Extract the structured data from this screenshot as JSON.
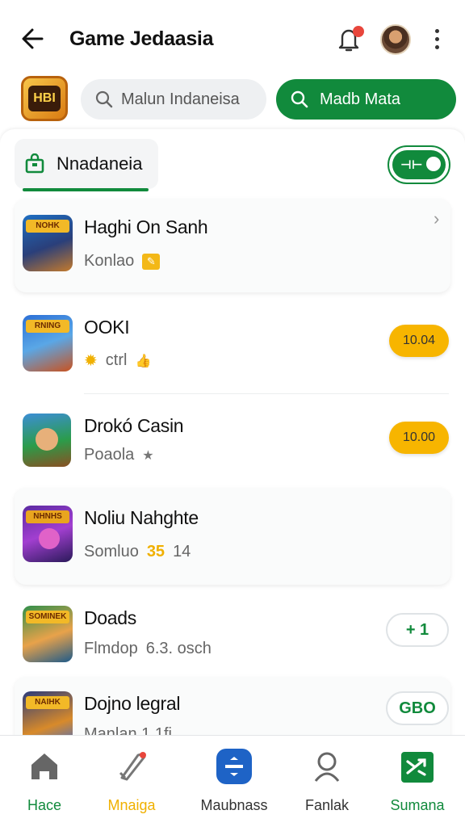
{
  "header": {
    "title": "Game Jedaasia",
    "back_icon": "arrow-left-icon",
    "notification_icon": "bell-icon",
    "menu_icon": "more-vert-icon"
  },
  "search_row": {
    "logo_text": "HBI",
    "search_placeholder": "Malun Indaneisa",
    "cta_label": "Madb Mata"
  },
  "filter": {
    "tab_label": "Nnadaneia",
    "toggle_label": "⊣⊢"
  },
  "games": [
    {
      "title": "Haghi On Sanh",
      "sub": "Konlao",
      "thumb_label": "NOHK",
      "action_type": "chevron"
    },
    {
      "title": "OOKI",
      "sub": "ctrl",
      "thumb_label": "RNING",
      "action_type": "price",
      "action_label": "10.04"
    },
    {
      "title": "Drokó Casin",
      "sub": "Poaola",
      "thumb_label": "",
      "action_type": "price",
      "action_label": "10.00"
    },
    {
      "title": "Noliu Nahghte",
      "sub": "Somluo",
      "sub_num1": "35",
      "sub_num2": "14",
      "thumb_label": "NHNHS",
      "action_type": "none"
    },
    {
      "title": "Doads",
      "sub": "Flmdop",
      "sub_extra": "6.3. osch",
      "thumb_label": "SOMINEK",
      "action_type": "pill",
      "action_label": "+ 1"
    },
    {
      "title": "Dojno legral",
      "sub": "Manlan 1.1fi",
      "thumb_label": "NAIHK",
      "action_type": "pill",
      "action_label": "GBO"
    }
  ],
  "bottom_nav": [
    {
      "label": "Hace",
      "icon": "home-icon",
      "color": "#118a3c"
    },
    {
      "label": "Mnaiga",
      "icon": "rocket-icon",
      "color": "#f0b000"
    },
    {
      "label": "Maubnass",
      "icon": "divide-icon",
      "color": "#333333"
    },
    {
      "label": "Fanlak",
      "icon": "person-icon",
      "color": "#333333"
    },
    {
      "label": "Sumana",
      "icon": "shuffle-icon",
      "color": "#118a3c"
    }
  ],
  "colors": {
    "brand_green": "#118a3c",
    "accent_yellow": "#f7b500",
    "notification_red": "#e8463c"
  }
}
